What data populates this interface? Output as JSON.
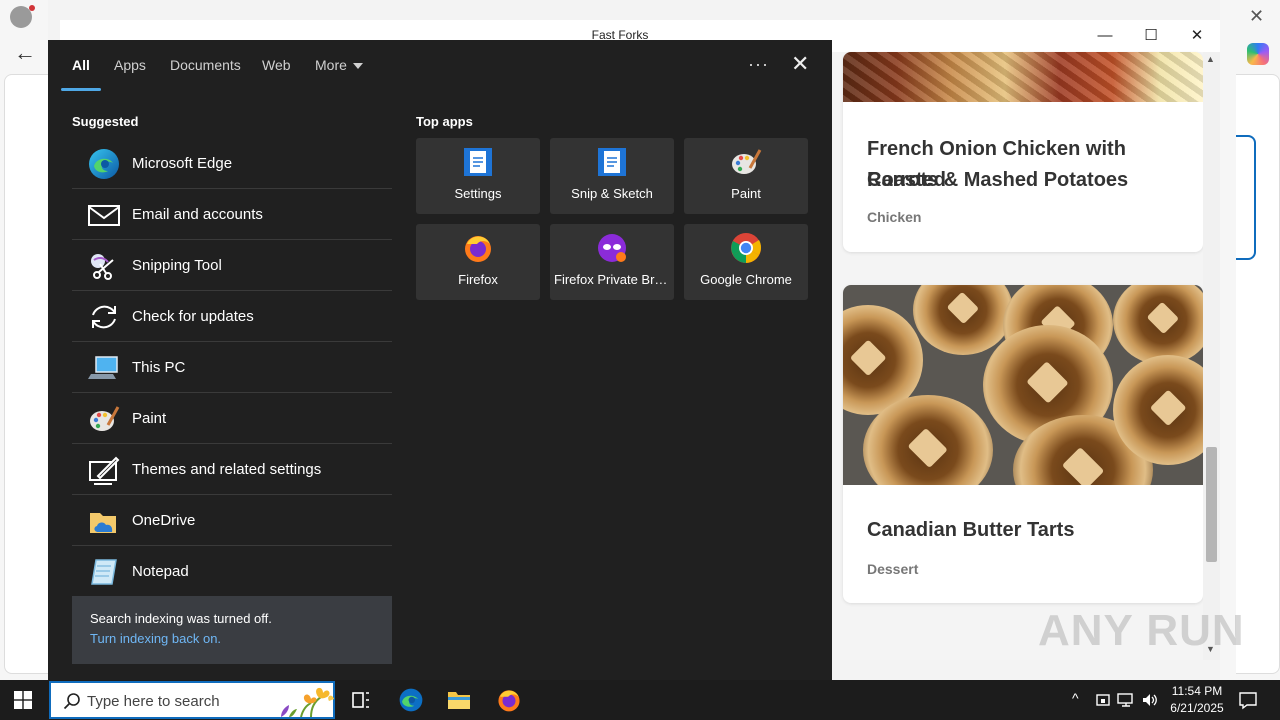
{
  "window": {
    "title": "Fast Forks",
    "minimize": "—",
    "maximize": "☐",
    "close": "✕"
  },
  "recipes": [
    {
      "title_line1": "French Onion Chicken with Roasted",
      "title_line2": "Carrots & Mashed Potatoes",
      "category": "Chicken"
    },
    {
      "title_line1": "Canadian Butter Tarts",
      "category": "Dessert"
    }
  ],
  "search_panel": {
    "tabs": {
      "all": "All",
      "apps": "Apps",
      "documents": "Documents",
      "web": "Web",
      "more": "More"
    },
    "options_icon": "more-options-icon",
    "close_icon": "close-icon",
    "suggested_heading": "Suggested",
    "top_apps_heading": "Top apps",
    "suggested": [
      {
        "label": "Microsoft Edge",
        "icon": "edge-icon"
      },
      {
        "label": "Email and accounts",
        "icon": "mail-icon"
      },
      {
        "label": "Snipping Tool",
        "icon": "scissors-icon"
      },
      {
        "label": "Check for updates",
        "icon": "refresh-icon"
      },
      {
        "label": "This PC",
        "icon": "computer-icon"
      },
      {
        "label": "Paint",
        "icon": "palette-icon"
      },
      {
        "label": "Themes and related settings",
        "icon": "pen-monitor-icon"
      },
      {
        "label": "OneDrive",
        "icon": "folder-cloud-icon"
      },
      {
        "label": "Notepad",
        "icon": "notepad-icon"
      }
    ],
    "top_apps": [
      {
        "label": "Settings",
        "icon": "document-blue-icon"
      },
      {
        "label": "Snip & Sketch",
        "icon": "document-blue-icon"
      },
      {
        "label": "Paint",
        "icon": "palette-icon"
      },
      {
        "label": "Firefox",
        "icon": "firefox-icon"
      },
      {
        "label": "Firefox Private Browsing",
        "icon": "firefox-private-icon"
      },
      {
        "label": "Google Chrome",
        "icon": "chrome-icon"
      }
    ],
    "notice": {
      "text": "Search indexing was turned off.",
      "link": "Turn indexing back on."
    }
  },
  "taskbar": {
    "search_placeholder": "Type here to search",
    "time": "11:54 PM",
    "date": "6/21/2025",
    "tray_chevron": "^"
  },
  "watermark": "ANY RUN",
  "colors": {
    "accent": "#0f6cbd",
    "link": "#6fb7f5",
    "panel_bg": "#202020",
    "tile_bg": "#333333"
  }
}
